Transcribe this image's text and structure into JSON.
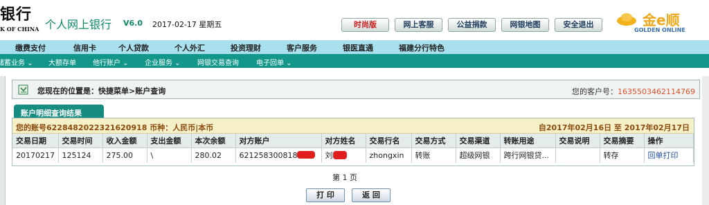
{
  "header": {
    "bank_name": "银行",
    "bank_name_en": "K OF CHINA",
    "title": "个人网上银行",
    "version": "V6.0",
    "date": "2017-02-17 星期五",
    "buttons": [
      "时尚版",
      "网上客服",
      "公益捐款",
      "网银地图",
      "安全退出"
    ],
    "golden_cn": "金e顺",
    "golden_en": "GOLDEN ONLINE"
  },
  "main_nav": [
    "缴费支付",
    "信用卡",
    "个人贷款",
    "个人外汇",
    "投资理财",
    "客户服务",
    "银医直通",
    "福建分行特色"
  ],
  "sub_nav": [
    "储蓄业务 ⌄",
    "大额存单",
    "他行账户 ⌄",
    "企业服务 ⌄",
    "网银交易查询",
    "电子回单 ⌄"
  ],
  "breadcrumb": {
    "text": "您现在的位置是：快捷菜单>账户查询",
    "customer_label": "您的客户号：",
    "customer_no": "1635503462114769"
  },
  "tab": "账户明细查询结果",
  "account": {
    "line": "您的账号6228482022321620918 币种：人民币|本币",
    "range": "自2017年02月16日  至 2017年02月17日"
  },
  "table": {
    "headers": [
      "交易日期",
      "交易时间",
      "收入金额",
      "支出金额",
      "本次余额",
      "对方账户",
      "对方姓名",
      "交易行名",
      "交易方式",
      "交易渠道",
      "转账用途",
      "交易说明",
      "交易摘要",
      "操作"
    ],
    "row": {
      "date": "20170217",
      "time": "125124",
      "income": "275.00",
      "expense": "\\",
      "balance": "280.02",
      "account": "621258300818",
      "name": "刘",
      "bank": "zhongxin",
      "method": "转账",
      "channel": "超级网银",
      "purpose": "跨行网银贷...",
      "note": "",
      "summary": "转存",
      "action": "回单打印"
    }
  },
  "page_info": "第 1 页",
  "actions": {
    "print": "打 印",
    "back": "返 回"
  },
  "colors": {
    "accent": "#13978b",
    "nav": "#a9e0ee",
    "highlight": "#e0522b"
  }
}
